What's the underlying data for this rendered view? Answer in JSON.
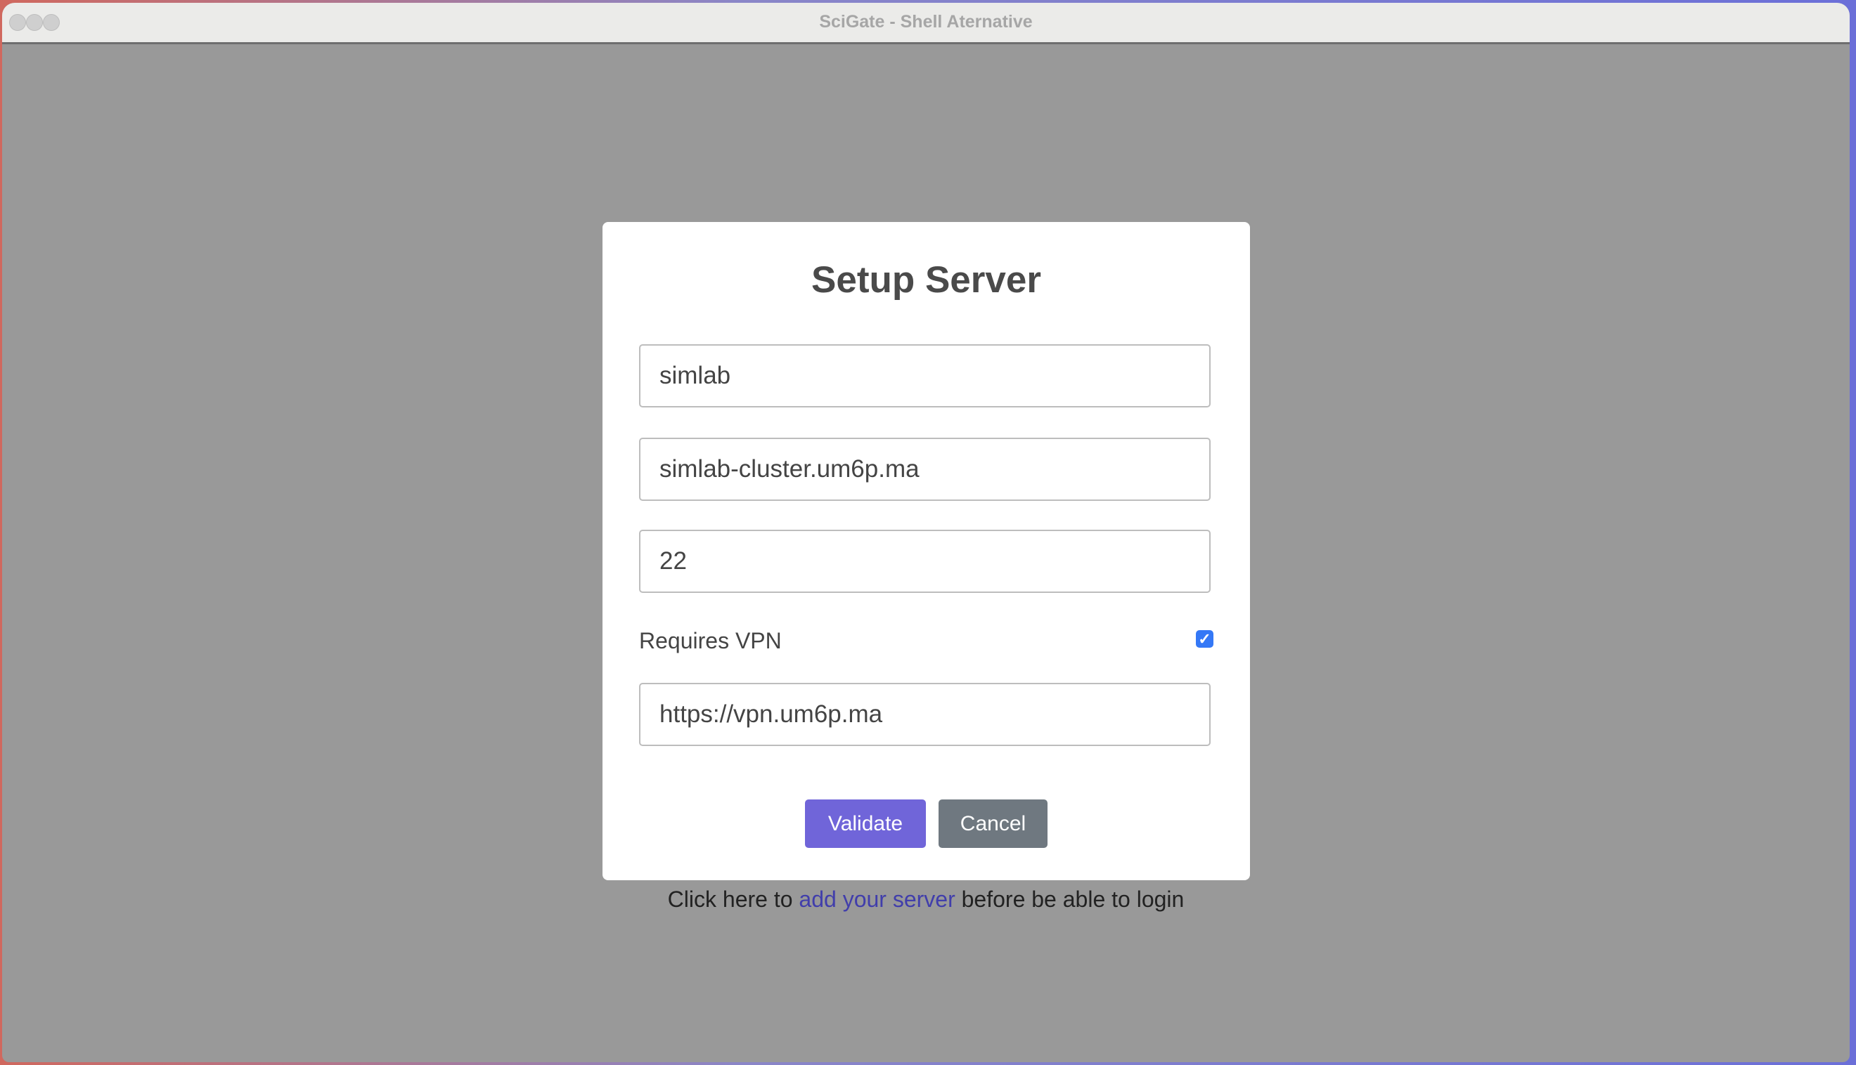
{
  "window": {
    "title": "SciGate - Shell Aternative"
  },
  "modal": {
    "title": "Setup Server",
    "fields": {
      "name": "simlab",
      "host": "simlab-cluster.um6p.ma",
      "port": "22",
      "vpn_url": "https://vpn.um6p.ma"
    },
    "vpn_label": "Requires VPN",
    "vpn_checked": true,
    "validate_label": "Validate",
    "cancel_label": "Cancel"
  },
  "footer": {
    "prefix": "Click here to",
    "link": "add your server",
    "suffix": "before be able to login"
  },
  "colors": {
    "accent": "#7065d9",
    "secondary": "#6f7880",
    "checkbox": "#3478f6",
    "link": "#413eab"
  }
}
